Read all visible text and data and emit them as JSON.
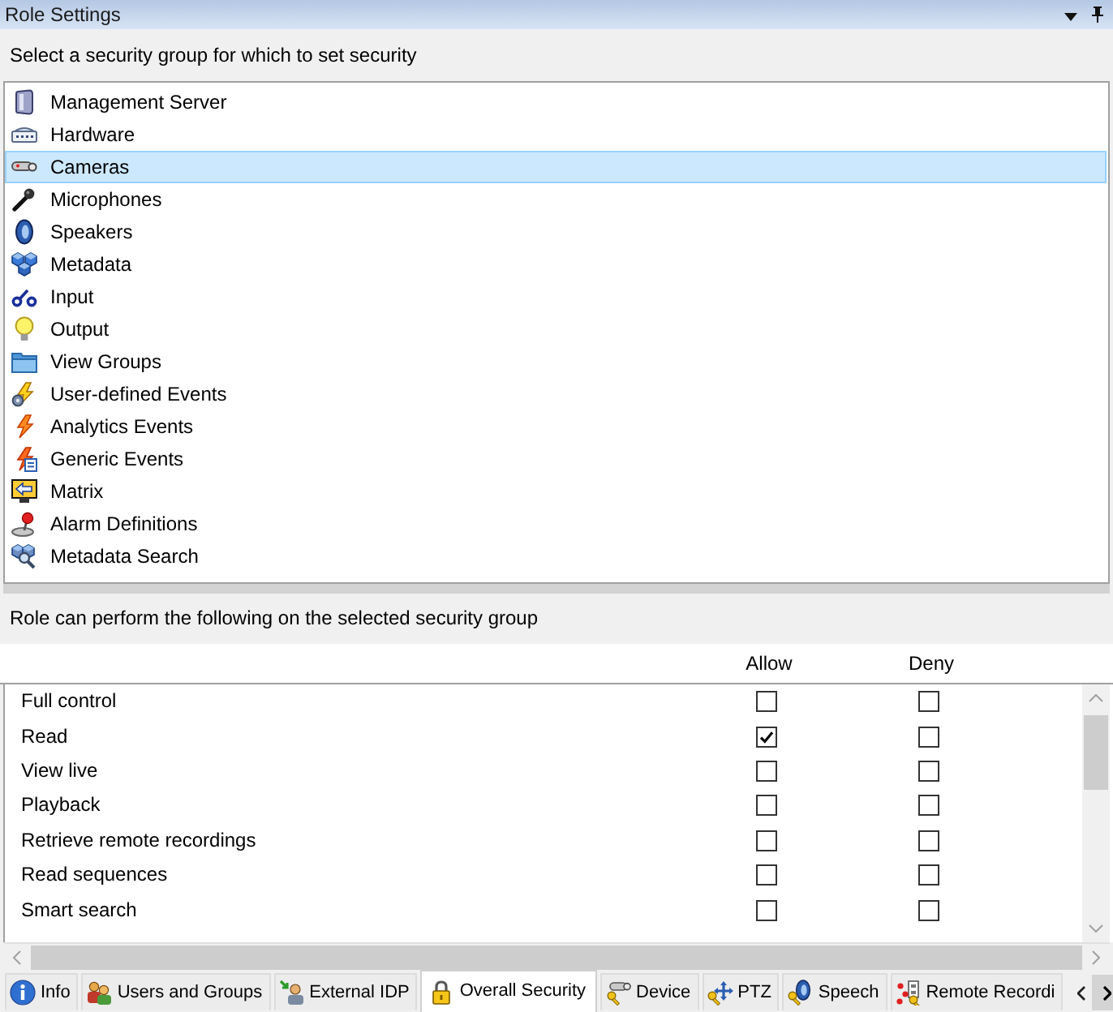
{
  "window": {
    "title": "Role Settings"
  },
  "groups": {
    "label": "Select a security group for which to set security",
    "items": [
      {
        "label": "Management Server",
        "kind": "server",
        "selected": false
      },
      {
        "label": "Hardware",
        "kind": "hardware",
        "selected": false
      },
      {
        "label": "Cameras",
        "kind": "camera",
        "selected": true
      },
      {
        "label": "Microphones",
        "kind": "microphone",
        "selected": false
      },
      {
        "label": "Speakers",
        "kind": "speaker",
        "selected": false
      },
      {
        "label": "Metadata",
        "kind": "metadata",
        "selected": false
      },
      {
        "label": "Input",
        "kind": "input",
        "selected": false
      },
      {
        "label": "Output",
        "kind": "output",
        "selected": false
      },
      {
        "label": "View Groups",
        "kind": "folder",
        "selected": false
      },
      {
        "label": "User-defined Events",
        "kind": "userevent",
        "selected": false
      },
      {
        "label": "Analytics Events",
        "kind": "analytics",
        "selected": false
      },
      {
        "label": "Generic Events",
        "kind": "generic",
        "selected": false
      },
      {
        "label": "Matrix",
        "kind": "matrix",
        "selected": false
      },
      {
        "label": "Alarm Definitions",
        "kind": "alarm",
        "selected": false
      },
      {
        "label": "Metadata Search",
        "kind": "metasearch",
        "selected": false
      }
    ]
  },
  "permissions": {
    "label": "Role can perform the following on the selected security group",
    "columns": [
      "Allow",
      "Deny"
    ],
    "rows": [
      {
        "label": "Full control",
        "allow": false,
        "deny": false
      },
      {
        "label": "Read",
        "allow": true,
        "deny": false
      },
      {
        "label": "View live",
        "allow": false,
        "deny": false
      },
      {
        "label": "Playback",
        "allow": false,
        "deny": false
      },
      {
        "label": "Retrieve remote recordings",
        "allow": false,
        "deny": false
      },
      {
        "label": "Read sequences",
        "allow": false,
        "deny": false
      },
      {
        "label": "Smart search",
        "allow": false,
        "deny": false
      }
    ]
  },
  "tabs": [
    {
      "label": "Info",
      "kind": "info",
      "selected": false
    },
    {
      "label": "Users and Groups",
      "kind": "users",
      "selected": false
    },
    {
      "label": "External IDP",
      "kind": "idp",
      "selected": false
    },
    {
      "label": "Overall Security",
      "kind": "security",
      "selected": true
    },
    {
      "label": "Device",
      "kind": "device",
      "selected": false
    },
    {
      "label": "PTZ",
      "kind": "ptz",
      "selected": false
    },
    {
      "label": "Speech",
      "kind": "speech",
      "selected": false
    },
    {
      "label": "Remote Recordi",
      "kind": "remote",
      "selected": false
    }
  ]
}
